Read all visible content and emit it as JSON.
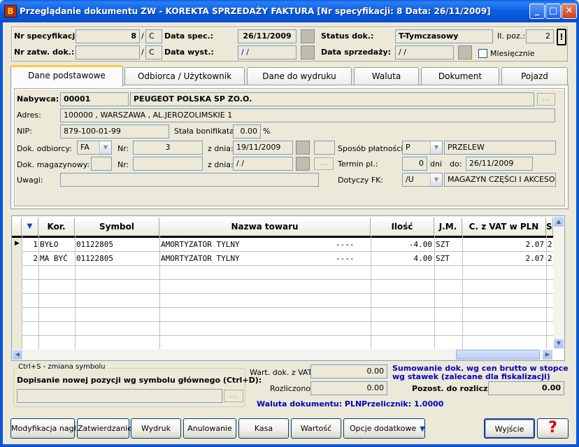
{
  "window": {
    "title": "Przeglądanie dokumentu ZW - KOREKTA SPRZEDAŻY FAKTURA   [Nr specyfikacji:      8  Data: 26/11/2009]",
    "icon_text": "B",
    "min": "_",
    "max": "□",
    "close": "✕"
  },
  "header": {
    "nr_spec_label": "Nr specyfikacji:",
    "nr_spec_value": "8",
    "nr_spec_suffix": "C",
    "nr_zatw_label": "Nr zatw. dok.:",
    "nr_zatw_value": "",
    "nr_zatw_suffix": "C",
    "slash": "/",
    "data_spec_label": "Data spec.:",
    "data_spec_value": "26/11/2009",
    "data_wyst_label": "Data wyst.:",
    "data_wyst_value": " / /",
    "status_label": "Status dok.:",
    "status_value": "T-Tymczasowy",
    "data_sprz_label": "Data sprzedaży:",
    "data_sprz_value": " / /",
    "il_poz_label": "Il. poz.:",
    "il_poz_value": "2",
    "alert_btn": "!",
    "miesiecznie_label": "Miesięcznie"
  },
  "tabs": [
    {
      "label": "Dane podstawowe"
    },
    {
      "label": "Odbiorca / Użytkownik"
    },
    {
      "label": "Dane do wydruku"
    },
    {
      "label": "Waluta"
    },
    {
      "label": "Dokument"
    },
    {
      "label": "Pojazd"
    }
  ],
  "form": {
    "nabywca_label": "Nabywca:",
    "nabywca_code": "00001",
    "nabywca_name": "PEUGEOT POLSKA SP ZO.O.",
    "dots": "...",
    "adres_label": "Adres:",
    "adres_value": "100000 , WARSZAWA , AL.JEROZOLIMSKIE    1",
    "nip_label": "NIP:",
    "nip_value": "879-100-01-99",
    "bonif_label": "Stała bonifikata:",
    "bonif_value": "0.00",
    "bonif_unit": "%",
    "dok_odb_label": "Dok. odbiorcy:",
    "dok_odb_value": "FA",
    "nr_label": "Nr:",
    "dok_odb_nr": "3",
    "z_dnia_label": "z dnia:",
    "dok_odb_date": "19/11/2009",
    "dok_mag_label": "Dok. magazynowy:",
    "dok_mag_nr": "",
    "dok_mag_date": " / /",
    "uwagi_label": "Uwagi:",
    "uwagi_value": "",
    "sposob_label": "Sposób płatności:",
    "sposob_code": "P",
    "sposob_name": "PRZELEW",
    "termin_label": "Termin pl.:",
    "termin_value": "0",
    "dni_label": "dni",
    "do_label": "do:",
    "termin_date": "26/11/2009",
    "dotyczy_label": "Dotyczy FK:",
    "dotyczy_code": "/U",
    "dotyczy_name": "MAGAZYN CZĘŚCI I AKCESOR"
  },
  "table": {
    "columns": [
      "Kor.",
      "Symbol",
      "Nazwa towaru",
      "Ilość",
      "J.M.",
      "C. z VAT w PLN",
      "S"
    ],
    "rows": [
      {
        "lp": "1",
        "kor": "BYŁO",
        "symbol": "01122805",
        "nazwa": "AMORTYZATOR TYLNY",
        "dash": "----",
        "ilosc": "-4.00",
        "jm": "SZT",
        "cena": "2.07",
        "s": "2"
      },
      {
        "lp": "2",
        "kor": "MA BYĆ",
        "symbol": "01122805",
        "nazwa": "AMORTYZATOR TYLNY",
        "dash": "----",
        "ilosc": "4.00",
        "jm": "SZT",
        "cena": "2.07",
        "s": "2"
      }
    ]
  },
  "bottom": {
    "group_label": "Ctrl+S - zmiana symbolu",
    "dopisanie_label": "Dopisanie nowej pozycji wg symbolu głównego (Ctrl+D):",
    "dopisanie_value": "",
    "wart_label": "Wart. dok. z VAT:",
    "wart_value": "0.00",
    "rozl_label": "Rozliczono:",
    "rozl_value": "0.00",
    "sumowanie_line1": "Sumowanie dok. wg cen brutto w stopce",
    "sumowanie_line2": "wg stawek (zalecane dla fiskalizacji)",
    "pozost_label": "Pozost. do rozlicz.:",
    "pozost_value": "0.00",
    "waluta_text": "Waluta dokumentu: PLN",
    "przelicznik_text": "Przelicznik: 1.0000"
  },
  "buttons": {
    "modyfikacja": "Modyfikacja nagł.",
    "zatwierdzanie": "Zatwierdzanie",
    "wydruk": "Wydruk",
    "anulowanie": "Anulowanie",
    "kasa": "Kasa",
    "wartosc": "Wartość",
    "opcje": "Opcje dodatkowe",
    "wyjscie": "Wyjście",
    "help": "?"
  }
}
